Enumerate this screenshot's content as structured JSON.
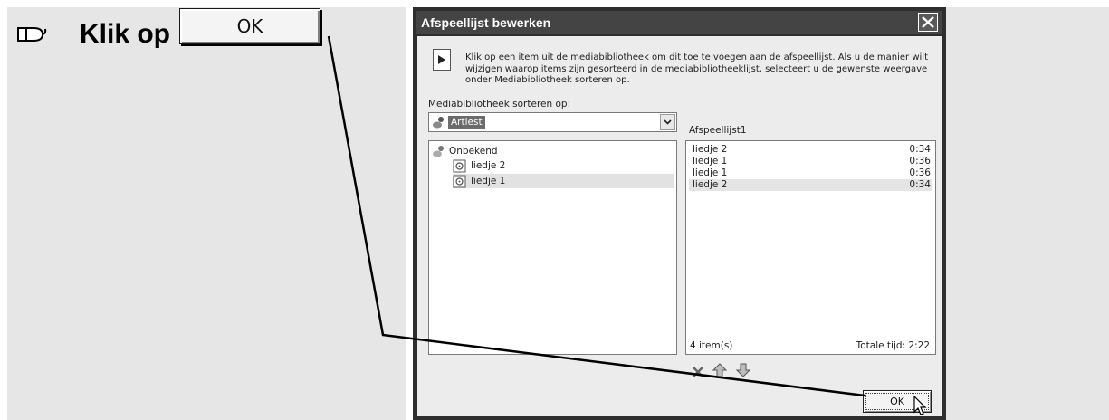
{
  "instruction": {
    "text": "Klik op",
    "ok_label": "OK",
    "icon": "mouse-icon"
  },
  "dialog": {
    "title": "Afspeellijst bewerken",
    "close_icon": "close-icon",
    "info_icon": "play-icon",
    "info_line1": "Klik op een item uit de mediabibliotheek om dit toe te voegen aan de afspeellijst. Als u de manier wilt",
    "info_line2": "wijzigen waarop items zijn gesorteerd in de mediabibliotheeklijst, selecteert u de gewenste weergave",
    "info_line3": "onder Mediabibliotheek sorteren op.",
    "sort_label": "Mediabibliotheek sorteren op:",
    "sort_value": "Artiest",
    "playlist_name": "Afspeellijst1",
    "tree": [
      {
        "label": "Onbekend"
      },
      {
        "label": "liedje 2"
      },
      {
        "label": "liedje 1"
      }
    ],
    "playlist": [
      {
        "title": "liedje 2",
        "duration": "0:34"
      },
      {
        "title": "liedje 1",
        "duration": "0:36"
      },
      {
        "title": "liedje 1",
        "duration": "0:36"
      },
      {
        "title": "liedje 2",
        "duration": "0:34"
      }
    ],
    "item_count": "4 item(s)",
    "total_time": "Totale tijd: 2:22",
    "toolbar": [
      "delete-icon",
      "move-up-icon",
      "move-down-icon"
    ],
    "ok_label": "OK"
  },
  "colors": {
    "titlebar": "#444444",
    "dialog_bg": "#ececec",
    "side_panel": "#e6e6e6",
    "selection": "#6b6b6b"
  }
}
